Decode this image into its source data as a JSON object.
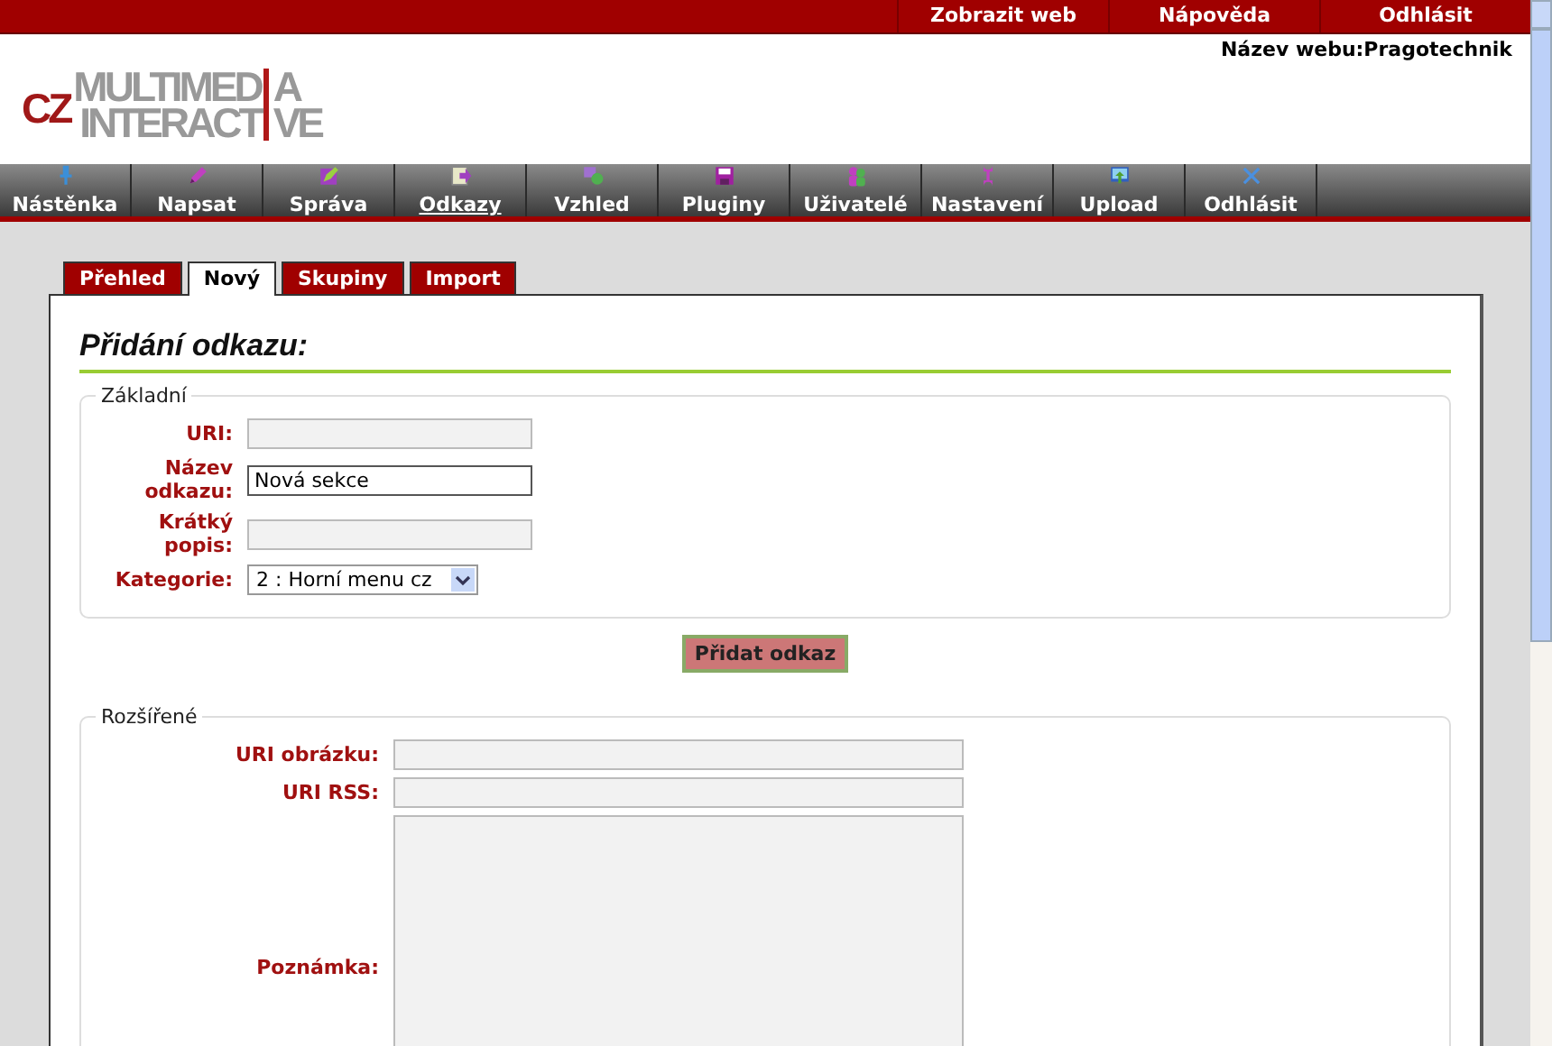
{
  "top_links": [
    "Zobrazit web",
    "Nápověda",
    "Odhlásit"
  ],
  "site_name": "Název webu:Pragotechnik",
  "logo": {
    "prefix": "CZ",
    "line1_start": "MULTIMED",
    "line1_end": "A",
    "line2_start": "INTERACT",
    "line2_end": "VE"
  },
  "nav": [
    {
      "label": "Nástěnka",
      "selected": false
    },
    {
      "label": "Napsat",
      "selected": false
    },
    {
      "label": "Správa",
      "selected": false
    },
    {
      "label": "Odkazy",
      "selected": true
    },
    {
      "label": "Vzhled",
      "selected": false
    },
    {
      "label": "Pluginy",
      "selected": false
    },
    {
      "label": "Uživatelé",
      "selected": false
    },
    {
      "label": "Nastavení",
      "selected": false
    },
    {
      "label": "Upload",
      "selected": false
    },
    {
      "label": "Odhlásit",
      "selected": false
    }
  ],
  "tabs": [
    {
      "label": "Přehled",
      "selected": false
    },
    {
      "label": "Nový",
      "selected": true
    },
    {
      "label": "Skupiny",
      "selected": false
    },
    {
      "label": "Import",
      "selected": false
    }
  ],
  "heading": "Přidání odkazu:",
  "basic": {
    "legend": "Základní",
    "fields": [
      {
        "kind": "text",
        "label": "URI:",
        "focused": false
      },
      {
        "kind": "text",
        "label": "Název odkazu:",
        "value": "Nová sekce",
        "focused": true
      },
      {
        "kind": "text",
        "label": "Krátký popis:",
        "focused": false
      },
      {
        "kind": "select",
        "label": "Kategorie:",
        "value": "2 : Horní menu cz",
        "focused": false
      }
    ]
  },
  "submit": "Přidat odkaz",
  "advanced": {
    "legend": "Rozšířené",
    "fields": [
      {
        "kind": "text",
        "label": "URI obrázku:",
        "focused": false
      },
      {
        "kind": "text",
        "label": "URI RSS:",
        "focused": false
      },
      {
        "kind": "textarea",
        "label": "Poznámka:",
        "focused": false
      }
    ]
  }
}
